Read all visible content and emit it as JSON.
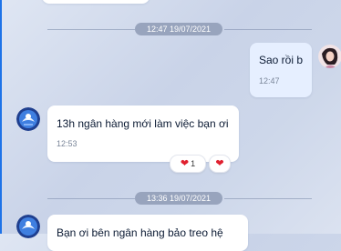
{
  "timestamps": [
    "12:47 19/07/2021",
    "13:36 19/07/2021"
  ],
  "messages": [
    {
      "text": "Sao rồi b",
      "time": "12:47"
    },
    {
      "text": "13h ngân hàng mới làm việc bạn ơi",
      "time": "12:53",
      "reaction_count": "1"
    },
    {
      "text": "Bạn ơi bên ngân hàng bảo treo hệ"
    }
  ],
  "icons": {
    "reaction": "heart-icon",
    "add_reaction": "heart-icon",
    "contact_avatar": "avatar-blue-emblem",
    "user_avatar": "avatar-photo"
  },
  "colors": {
    "heart": "#e0202f",
    "edge_accent": "#1e73e8",
    "separator_pill": "#98a4bd"
  }
}
